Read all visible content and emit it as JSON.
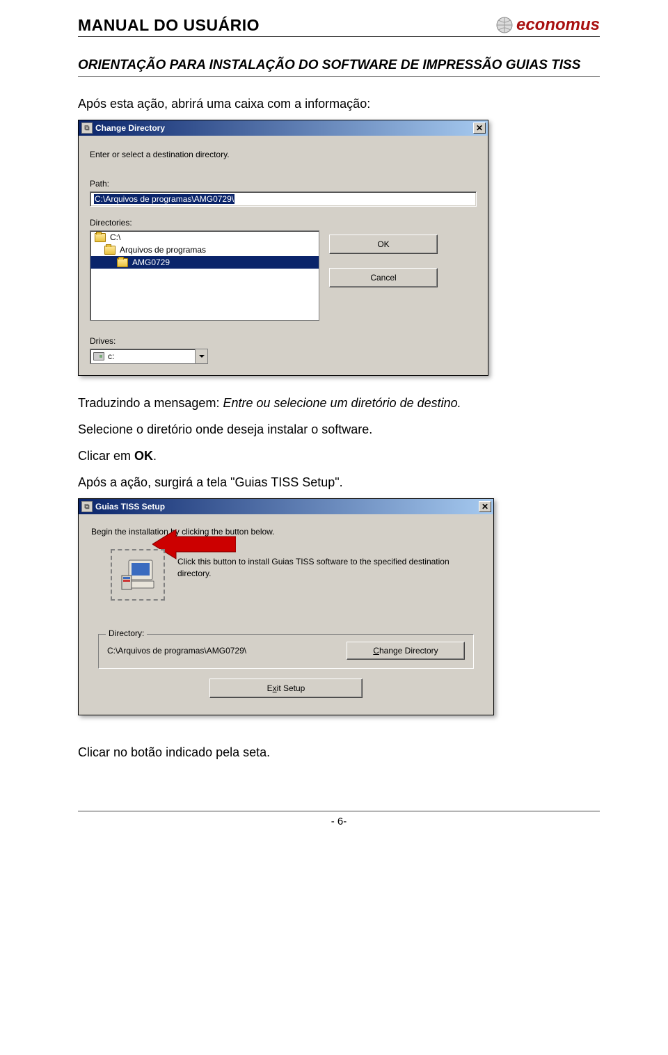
{
  "header": {
    "title": "MANUAL DO USUÁRIO",
    "logo_text": "economus"
  },
  "subheader": "ORIENTAÇÃO PARA INSTALAÇÃO DO SOFTWARE DE IMPRESSÃO GUIAS TISS",
  "para1": "Após esta ação, abrirá uma caixa com a informação:",
  "dialog1": {
    "title": "Change Directory",
    "instruction": "Enter or select a destination directory.",
    "path_label": "Path:",
    "path_value": "C:\\Arquivos de programas\\AMG0729\\",
    "directories_label": "Directories:",
    "dir_items": [
      "C:\\",
      "Arquivos de programas",
      "AMG0729"
    ],
    "ok_label": "OK",
    "cancel_label": "Cancel",
    "drives_label": "Drives:",
    "drive_value": "c:"
  },
  "para2_prefix": "Traduzindo a mensagem: ",
  "para2_italic": "Entre ou selecione um diretório de destino.",
  "para3": "Selecione o diretório onde deseja instalar o software.",
  "para4_prefix": "Clicar em ",
  "para4_bold": "OK",
  "para4_suffix": ".",
  "para5": "Após a ação, surgirá a tela \"Guias TISS Setup\".",
  "dialog2": {
    "title": "Guias TISS Setup",
    "instruction": "Begin the installation by clicking the button below.",
    "install_desc": "Click this button to install Guias TISS software to the specified destination directory.",
    "fieldset_legend": "Directory:",
    "dir_value": "C:\\Arquivos de programas\\AMG0729\\",
    "change_dir_label": "Change Directory",
    "exit_label": "Exit Setup"
  },
  "para6": "Clicar no botão indicado pela seta.",
  "footer": "- 6-"
}
